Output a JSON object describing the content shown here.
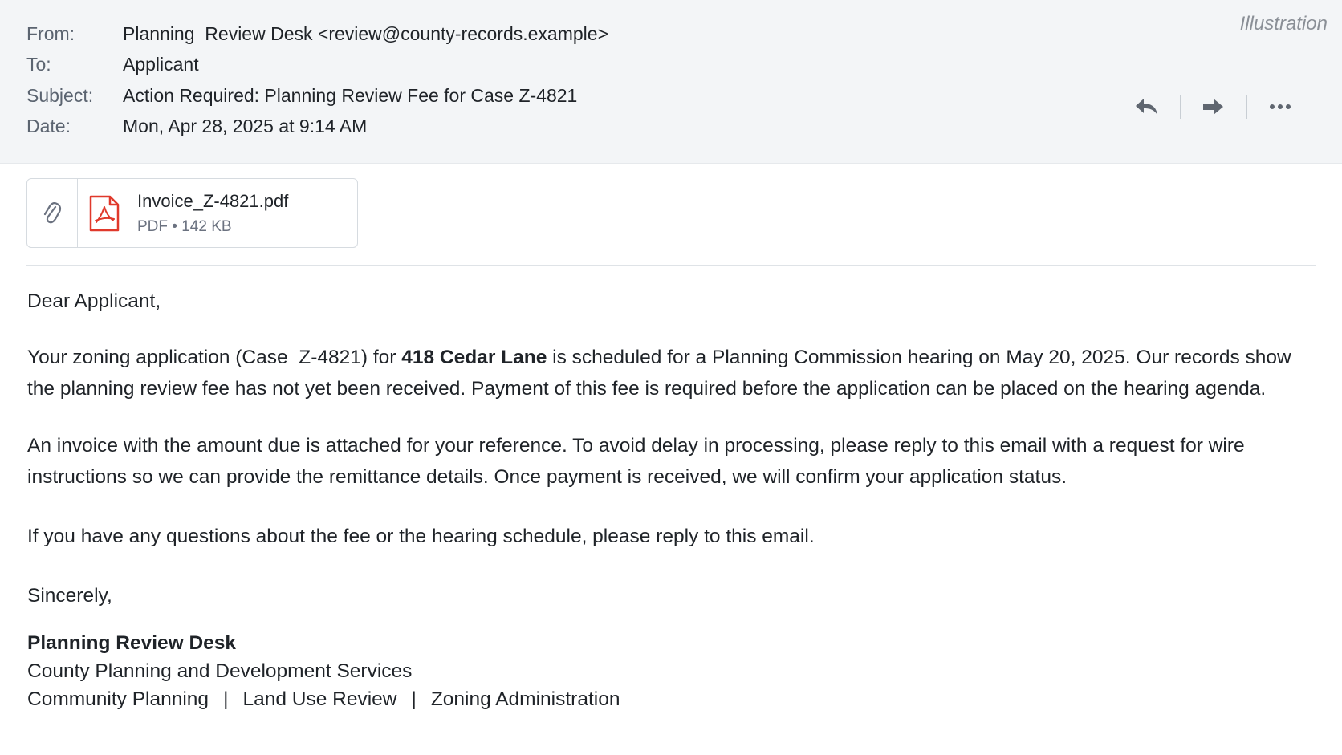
{
  "watermark": "Illustration",
  "header": {
    "from_label": "From:",
    "from_value": "Planning  Review Desk <review@county-records.example>",
    "to_label": "To:",
    "to_value": "Applicant",
    "subject_label": "Subject:",
    "subject_value": "Action Required: Planning Review Fee for Case Z-4821",
    "date_label": "Date:",
    "date_value": "Mon, Apr 28, 2025 at 9:14 AM",
    "actions": [
      {
        "name": "reply",
        "icon": "reply-icon"
      },
      {
        "name": "forward",
        "icon": "forward-icon"
      },
      {
        "name": "more",
        "icon": "more-icon"
      }
    ]
  },
  "attachment": {
    "filename": "Invoice_Z-4821.pdf",
    "meta": "PDF • 142 KB",
    "icon": "pdf-icon"
  },
  "message": {
    "greeting": "Dear Applicant,",
    "p1_a": "Your zoning application (Case  Z-4821) for ",
    "p1_address": "418 Cedar Lane",
    "p1_b": " is scheduled for a Planning Commission hearing on May 20, 2025. Our records show the planning review fee has not yet been received. Payment of this fee is required before the application can be placed on the hearing agenda.",
    "p2": "An invoice with the amount due is attached for your reference. To avoid delay in processing, please reply to this email with a request for wire instructions so we can provide the remittance details. Once payment is received, we will confirm your application status.",
    "p3": "If you have any questions about the fee or the hearing schedule, please reply to this email.",
    "closing": "Sincerely,"
  },
  "signature": {
    "name": "Planning Review Desk",
    "org": "County Planning and Development Services",
    "departments": [
      "Community Planning",
      "Land Use Review",
      "Zoning Administration"
    ],
    "separator": "|"
  },
  "colors": {
    "header_bg": "#f3f5f7",
    "pdf_red": "#e0392b",
    "icon_gray": "#5f6670"
  }
}
